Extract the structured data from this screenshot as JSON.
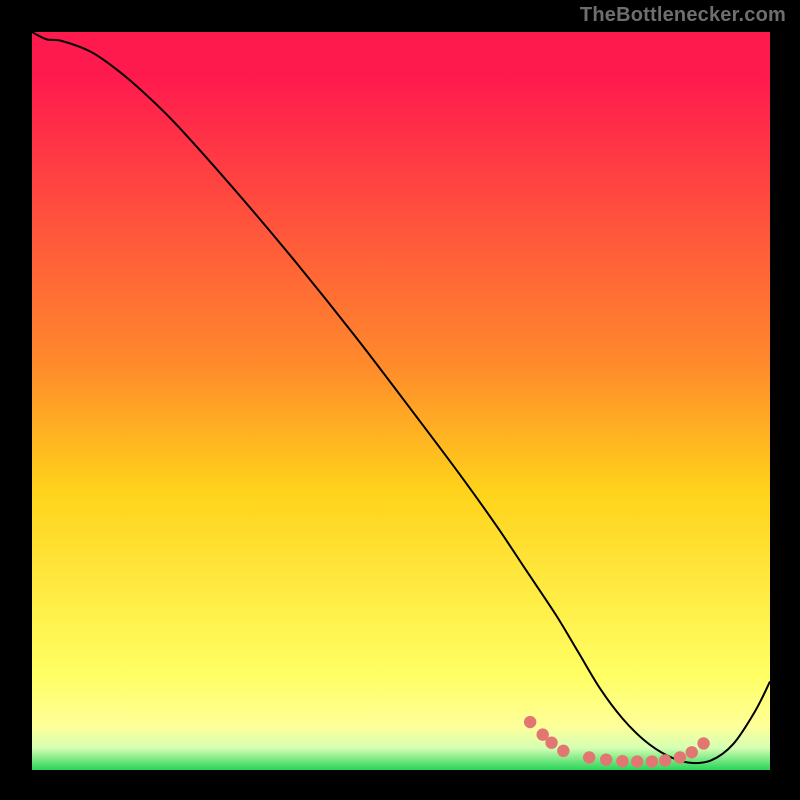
{
  "watermark": "TheBottlenecker.com",
  "colors": {
    "bg_page": "#000000",
    "bg_plot": "#ffffff",
    "curve": "#000000",
    "markers": "#e27772",
    "grad_top": "#ff1a4e",
    "grad_mid": "#ffd21b",
    "grad_low": "#ffff99",
    "grad_green": "#28d45a"
  },
  "chart_data": {
    "type": "line",
    "title": "",
    "xlabel": "",
    "ylabel": "",
    "xlim": [
      0,
      100
    ],
    "ylim": [
      0,
      100
    ],
    "series": [
      {
        "name": "curve",
        "x": [
          0,
          2,
          4,
          8,
          12,
          16,
          20,
          28,
          36,
          44,
          52,
          58,
          63,
          67,
          71,
          74,
          77,
          80,
          83,
          86,
          89,
          92,
          95,
          98,
          100
        ],
        "y": [
          100,
          99,
          98.8,
          97.3,
          94.5,
          91,
          87,
          78,
          68.5,
          58.5,
          48,
          40,
          33,
          27,
          21,
          16,
          11,
          7,
          4,
          2,
          1,
          1.3,
          3.5,
          8,
          12
        ]
      }
    ],
    "markers": [
      {
        "x": 67.5,
        "y": 6.5
      },
      {
        "x": 69.2,
        "y": 4.8
      },
      {
        "x": 70.4,
        "y": 3.7
      },
      {
        "x": 72.0,
        "y": 2.6
      },
      {
        "x": 75.5,
        "y": 1.7
      },
      {
        "x": 77.8,
        "y": 1.4
      },
      {
        "x": 80.0,
        "y": 1.2
      },
      {
        "x": 82.0,
        "y": 1.15
      },
      {
        "x": 84.0,
        "y": 1.15
      },
      {
        "x": 85.8,
        "y": 1.3
      },
      {
        "x": 87.8,
        "y": 1.7
      },
      {
        "x": 89.4,
        "y": 2.4
      },
      {
        "x": 91.0,
        "y": 3.6
      }
    ]
  }
}
